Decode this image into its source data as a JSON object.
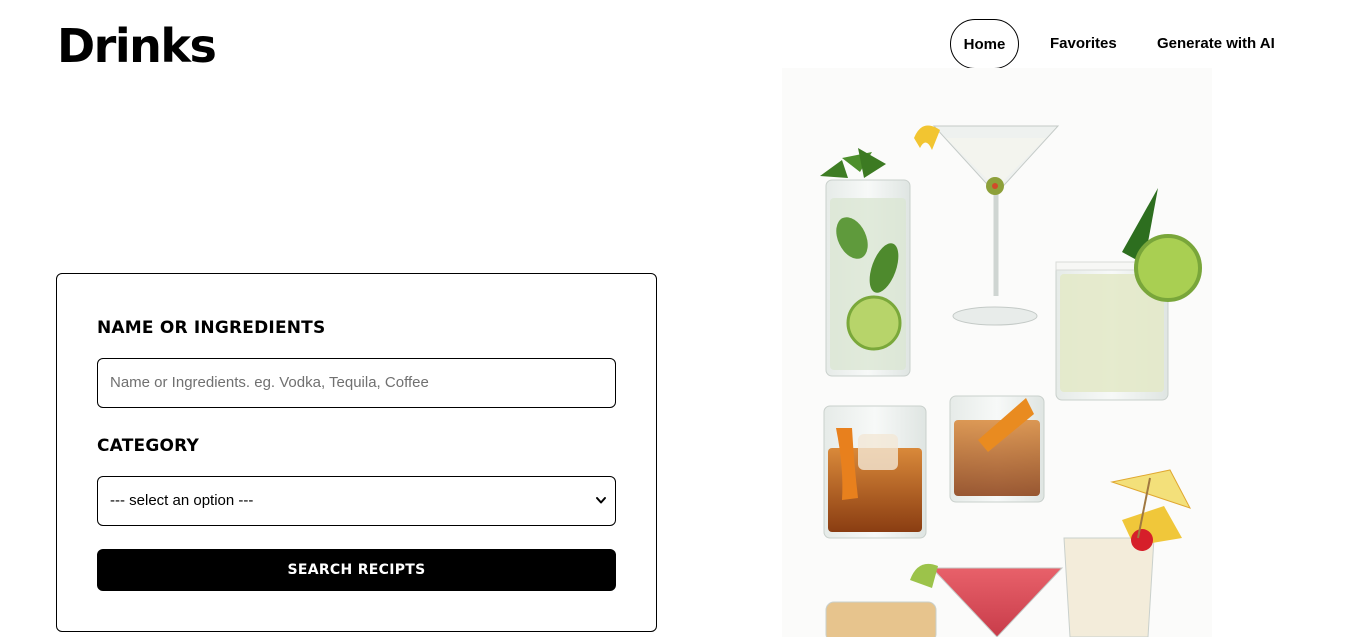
{
  "header": {
    "logo": "Drinks",
    "nav": {
      "home": "Home",
      "favorites": "Favorites",
      "generate_ai": "Generate with AI"
    }
  },
  "search_form": {
    "name_label": "NAME OR INGREDIENTS",
    "name_placeholder": "Name or Ingredients. eg. Vodka, Tequila, Coffee",
    "category_label": "CATEGORY",
    "category_selected": "--- select an option ---",
    "submit_label": "SEARCH RECIPTS"
  }
}
